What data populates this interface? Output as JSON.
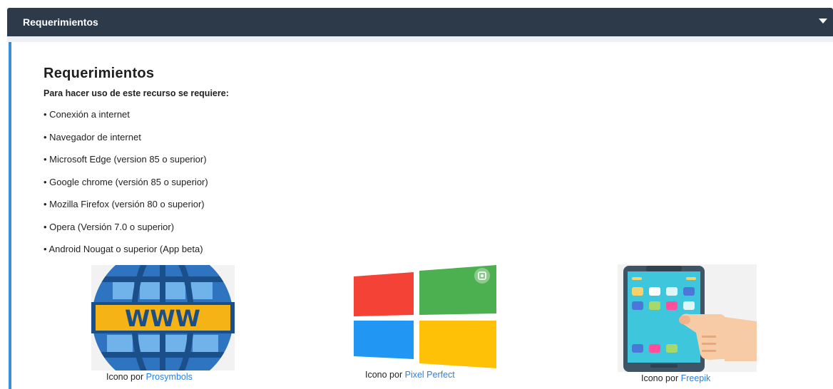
{
  "accordion": {
    "title": "Requerimientos"
  },
  "content": {
    "title": "Requerimientos",
    "intro": "Para hacer uso de este recurso se requiere:",
    "requirements": [
      "• Conexión a internet",
      "• Navegador de internet",
      "• Microsoft Edge (version 85 o superior)",
      "• Google chrome (versión 85 o superior)",
      "• Mozilla Firefox (versión 80 o superior)",
      "• Opera (Versión 7.0 o superior)",
      "• Android Nougat o superior (App beta)"
    ]
  },
  "icons": [
    {
      "icon": "www-globe-icon",
      "caption_prefix": "Icono por",
      "author": "Prosymbols"
    },
    {
      "icon": "windows-logo-icon",
      "caption_prefix": "Icono por",
      "author": "Pixel Perfect"
    },
    {
      "icon": "smartphone-touch-icon",
      "caption_prefix": "Icono por",
      "author": "Freepik"
    }
  ],
  "colors": {
    "header_bg": "#2c3a4a",
    "accent_border": "#3b8fd6",
    "link": "#2a7fe0"
  }
}
